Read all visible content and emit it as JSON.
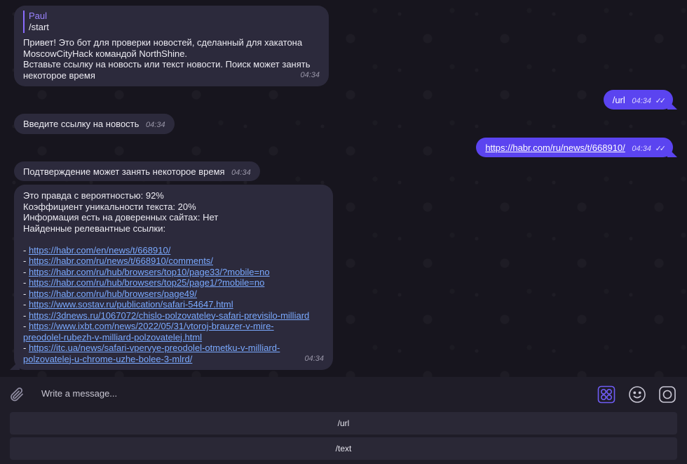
{
  "messages": {
    "m1": {
      "reply_name": "Paul",
      "reply_text": "/start",
      "lines": [
        "Привет! Это бот для проверки новостей, сделанный для хакатона",
        "MoscowCityHack командой NorthShine.",
        "Вставьте ссылку на новость или текст новости. Поиск может занять",
        "некоторое время"
      ],
      "time": "04:34"
    },
    "m2": {
      "text": "/url",
      "time": "04:34"
    },
    "m3": {
      "text": "Введите ссылку на новость",
      "time": "04:34"
    },
    "m4": {
      "text": "https://habr.com/ru/news/t/668910/",
      "time": "04:34"
    },
    "m5": {
      "text": "Подтверждение может занять некоторое время",
      "time": "04:34"
    },
    "m6": {
      "lines": [
        "Это правда с вероятностью: 92%",
        "Коэффициент уникальности текста: 20%",
        "Информация есть на доверенных сайтах: Нет",
        "Найденные релевантные ссылки:"
      ],
      "dash": "- ",
      "links": [
        [
          "https://habr.com/en/news/t/668910/"
        ],
        [
          "https://habr.com/ru/news/t/668910/comments/"
        ],
        [
          "https://habr.com/ru/hub/browsers/top10/page33/?mobile=no"
        ],
        [
          "https://habr.com/ru/hub/browsers/top25/page1/?mobile=no"
        ],
        [
          "https://habr.com/ru/hub/browsers/page49/"
        ],
        [
          "https://www.sostav.ru/publication/safari-54647.html"
        ],
        [
          "https://3dnews.ru/1067072/chislo-polzovateley-safari-previsilo-milliard"
        ],
        [
          "https://www.ixbt.com/news/2022/05/31/vtoroj-brauzer-v-mire-",
          "preodolel-rubezh-v-milliard-polzovatelej.html"
        ],
        [
          "https://itc.ua/news/safari-vpervye-preodolel-otmetku-v-milliard-",
          "polzovatelej-u-chrome-uzhe-bolee-3-mlrd/"
        ]
      ],
      "time": "04:34"
    }
  },
  "read_ticks": "✓✓",
  "composer": {
    "placeholder": "Write a message..."
  },
  "keyboard": {
    "buttons": [
      "/url",
      "/text"
    ]
  },
  "icons": [
    "attach-icon",
    "bot-commands-icon",
    "emoji-icon",
    "instagram-icon"
  ],
  "colors": {
    "accent": "#5b44f0",
    "incoming": "#2c2a3c",
    "link": "#7aa9ff"
  }
}
